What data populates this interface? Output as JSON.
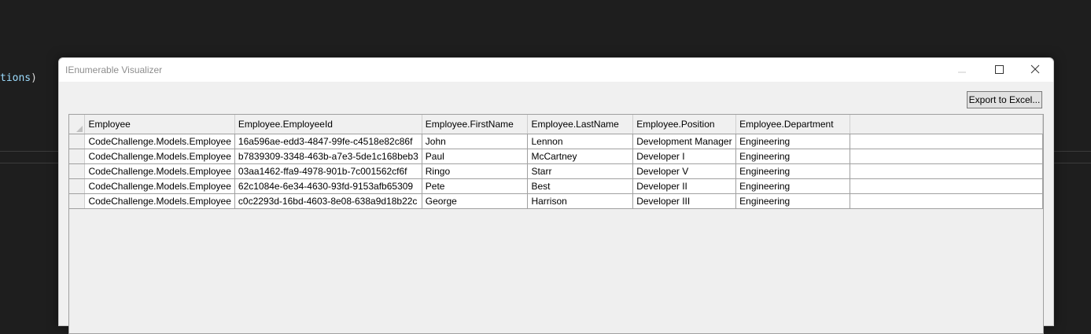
{
  "editor": {
    "code_fragment": "tions",
    "code_paren": ")"
  },
  "dialog": {
    "title": "IEnumerable Visualizer",
    "export_button": "Export to Excel...",
    "window_controls": [
      "minimize-icon",
      "maximize-icon",
      "close-icon"
    ]
  },
  "grid": {
    "columns": [
      "Employee",
      "Employee.EmployeeId",
      "Employee.FirstName",
      "Employee.LastName",
      "Employee.Position",
      "Employee.Department",
      ""
    ],
    "rows": [
      [
        "CodeChallenge.Models.Employee",
        "16a596ae-edd3-4847-99fe-c4518e82c86f",
        "John",
        "Lennon",
        "Development Manager",
        "Engineering",
        ""
      ],
      [
        "CodeChallenge.Models.Employee",
        "b7839309-3348-463b-a7e3-5de1c168beb3",
        "Paul",
        "McCartney",
        "Developer I",
        "Engineering",
        ""
      ],
      [
        "CodeChallenge.Models.Employee",
        "03aa1462-ffa9-4978-901b-7c001562cf6f",
        "Ringo",
        "Starr",
        "Developer V",
        "Engineering",
        ""
      ],
      [
        "CodeChallenge.Models.Employee",
        "62c1084e-6e34-4630-93fd-9153afb65309",
        "Pete",
        "Best",
        "Developer II",
        "Engineering",
        ""
      ],
      [
        "CodeChallenge.Models.Employee",
        "c0c2293d-16bd-4603-8e08-638a9d18b22c",
        "George",
        "Harrison",
        "Developer III",
        "Engineering",
        ""
      ]
    ]
  }
}
